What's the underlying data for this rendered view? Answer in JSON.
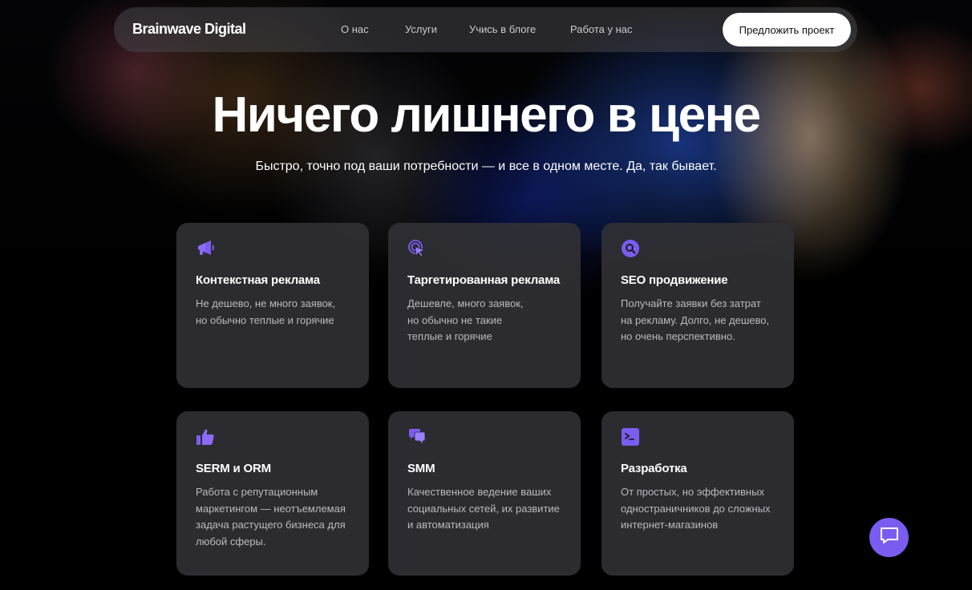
{
  "nav": {
    "brand": "Brainwave Digital",
    "links": [
      "О нас",
      "Услуги",
      "Учись в блоге",
      "Работа у нас"
    ],
    "cta": "Предложить проект"
  },
  "hero": {
    "title": "Ничего лишнего в цене",
    "subtitle": "Быстро, точно под ваши потребности — и все в одном месте. Да, так бывает."
  },
  "cards": [
    {
      "icon": "megaphone-icon",
      "title": "Контекстная реклама",
      "desc": "Не дешево, не много заявок,\nно обычно теплые и горячие"
    },
    {
      "icon": "target-cursor-icon",
      "title": "Таргетированная реклама",
      "desc": "Дешевле, много заявок,\nно обычно не такие\nтеплые и горячие"
    },
    {
      "icon": "search-icon",
      "title": "SEO продвижение",
      "desc": "Получайте заявки без затрат\nна рекламу. Долго, не дешево,\nно очень перспективно."
    },
    {
      "icon": "thumbs-up-icon",
      "title": "SERM и ORM",
      "desc": "Работа с репутационным\nмаркетингом — неотъемлемая\nзадача растущего бизнеса для\nлюбой сферы."
    },
    {
      "icon": "chat-bubbles-icon",
      "title": "SMM",
      "desc": "Качественное ведение ваших\nсоциальных сетей, их развитие\nи автоматизация"
    },
    {
      "icon": "terminal-icon",
      "title": "Разработка",
      "desc": "От простых, но эффективных\nодностраничников до сложных\nинтернет-магазинов"
    }
  ],
  "colors": {
    "accent": "#7b5cf0",
    "card_bg": "#303034",
    "nav_cta_bg": "#ffffff"
  },
  "chat_widget": {
    "icon": "chat-icon"
  }
}
